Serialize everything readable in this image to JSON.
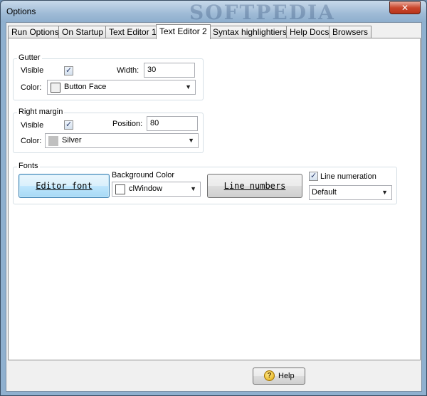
{
  "window": {
    "title": "Options",
    "watermark": "SOFTPEDIA",
    "close_glyph": "✕"
  },
  "tabs": [
    {
      "label": "Run Options",
      "active": false
    },
    {
      "label": "On Startup",
      "active": false
    },
    {
      "label": "Text Editor 1",
      "active": false
    },
    {
      "label": "Text Editor 2",
      "active": true
    },
    {
      "label": "Syntax highlightiers",
      "active": false
    },
    {
      "label": "Help Docs",
      "active": false
    },
    {
      "label": "Browsers",
      "active": false
    }
  ],
  "gutter": {
    "group_label": "Gutter",
    "visible_label": "Visible",
    "visible_checked": true,
    "width_label": "Width:",
    "width_value": "30",
    "color_label": "Color:",
    "color_value": "Button Face",
    "color_swatch": "#f0f0f0"
  },
  "right_margin": {
    "group_label": "Right margin",
    "visible_label": "Visible",
    "visible_checked": true,
    "position_label": "Position:",
    "position_value": "80",
    "color_label": "Color:",
    "color_value": "Silver",
    "color_swatch": "#c0c0c0"
  },
  "fonts": {
    "group_label": "Fonts",
    "editor_font_button": "Editor font",
    "background_color_label": "Background Color",
    "background_color_value": "clWindow",
    "background_swatch": "#ffffff",
    "line_numbers_button": "Line numbers",
    "line_numeration_label": "Line numeration",
    "line_numeration_checked": true,
    "line_numeration_value": "Default"
  },
  "footer": {
    "help_label": "Help",
    "help_icon_glyph": "?"
  },
  "icons": {
    "checkmark": "✓",
    "dropdown_arrow": "▼"
  }
}
